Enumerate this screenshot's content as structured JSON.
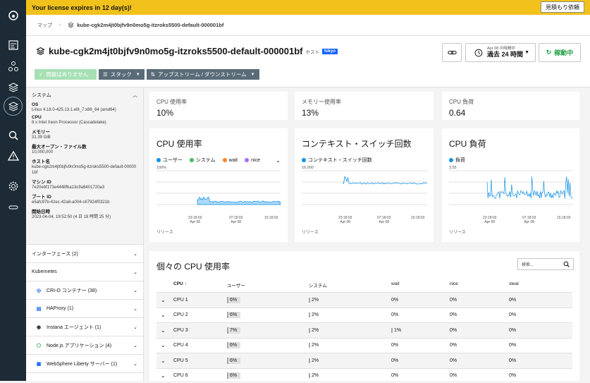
{
  "banner": {
    "text": "Your license expires in 12 day(s)!",
    "button": "見積もり依頼"
  },
  "breadcrumb": {
    "root": "マップ",
    "separator": "›",
    "host": "kube-cgk2m4jt0bjfv9n0mo5g-itzroks5500-default-000001bf"
  },
  "header": {
    "title": "kube-cgk2m4jt0bjfv9n0mo5g-itzroks5500-default-000001bf",
    "kind": "ホスト",
    "zone": "tokyo",
    "status": "問題はありません",
    "stack": "スタック",
    "upstream": "アップストリーム / ダウンストリーム",
    "time_small": "Apr 08 の時間中",
    "time_large": "過去 24 時間",
    "live": "稼動中"
  },
  "system": {
    "heading": "システム",
    "items": [
      {
        "k": "OS",
        "v": "Linux 4.18.0-425.13.1.el8_7.x86_64 (amd64)"
      },
      {
        "k": "CPU",
        "v": "8 x Intel Xeon Processor (Cascadelake)"
      },
      {
        "k": "メモリー",
        "v": "31.39 GiB"
      },
      {
        "k": "最大オープン・ファイル数",
        "v": "10,000,000"
      },
      {
        "k": "ホスト名",
        "v": "kube-cgk2m4jt0bjfv9n0mo5g-itzroks5500-default-000001bf"
      },
      {
        "k": "マシン ID",
        "v": "7e20ebf173e4448fba13c9a6401720a3"
      },
      {
        "k": "ブート ID",
        "v": "e5afc97b-42ec-42a8-a004-c67924f0321b"
      },
      {
        "k": "開始日時",
        "v": "2023-04-04, 19:52:50 (4 日 19 時間 25 分)"
      }
    ]
  },
  "accordions": [
    {
      "label": "インターフェース (2)"
    },
    {
      "label": "Kubernetes"
    }
  ],
  "services": [
    {
      "label": "CRI-O コンテナー (38)",
      "icon": "crio-icon"
    },
    {
      "label": "HAProxy (1)",
      "icon": "haproxy-icon"
    },
    {
      "label": "Instana エージェント (1)",
      "icon": "instana-icon"
    },
    {
      "label": "Node.js アプリケーション (4)",
      "icon": "nodejs-icon"
    },
    {
      "label": "WebSphere Liberty サーバー (1)",
      "icon": "websphere-icon"
    }
  ],
  "kpis": [
    {
      "label": "CPU 使用率",
      "value": "10%"
    },
    {
      "label": "メモリー使用率",
      "value": "13%"
    },
    {
      "label": "CPU 負荷",
      "value": "0.64"
    }
  ],
  "charts": {
    "cpu": {
      "title": "CPU 使用率",
      "legend": [
        {
          "name": "ユーザー",
          "color": "#1192e8"
        },
        {
          "name": "システム",
          "color": "#42be65"
        },
        {
          "name": "wait",
          "color": "#ff832b"
        },
        {
          "name": "nice",
          "color": "#a56eff"
        }
      ],
      "ymax": "100%",
      "ticks": [
        [
          "23:18:03",
          "Apr 08"
        ],
        [
          "07:18:03",
          "Apr 08"
        ],
        [
          "15:18:03",
          ""
        ]
      ],
      "footer": "リリース"
    },
    "ctx": {
      "title": "コンテキスト・スイッチ回数",
      "legend": [
        {
          "name": "コンテキスト・スイッチ回数",
          "color": "#1192e8"
        }
      ],
      "ymax": "16,000",
      "ticks": [
        [
          "23:18:03",
          "Apr 08"
        ],
        [
          "07:18:03",
          "Apr 08"
        ],
        [
          "15:18:03",
          ""
        ]
      ],
      "footer": "リリース"
    },
    "load": {
      "title": "CPU 負荷",
      "legend": [
        {
          "name": "負荷",
          "color": "#1192e8"
        }
      ],
      "ymax": "3.55",
      "ticks": [
        [
          "23:18:03",
          "Apr 08"
        ],
        [
          "07:18:03",
          "Apr 08"
        ],
        [
          "15:18:03",
          ""
        ]
      ],
      "footer": "リリース"
    }
  },
  "table": {
    "title": "個々の CPU 使用率",
    "search_placeholder": "検索...",
    "columns": [
      "CPU ↑",
      "ユーザー",
      "システム",
      "wait",
      "nice",
      "steal"
    ],
    "rows": [
      {
        "cpu": "CPU 1",
        "user": "6%",
        "sys": "2%",
        "wait": "0%",
        "nice": "0%",
        "steal": "0%"
      },
      {
        "cpu": "CPU 2",
        "user": "6%",
        "sys": "2%",
        "wait": "0%",
        "nice": "0%",
        "steal": "0%"
      },
      {
        "cpu": "CPU 3",
        "user": "7%",
        "sys": "2%",
        "wait": "1%",
        "nice": "0%",
        "steal": "0%"
      },
      {
        "cpu": "CPU 4",
        "user": "6%",
        "sys": "2%",
        "wait": "0%",
        "nice": "0%",
        "steal": "0%"
      },
      {
        "cpu": "CPU 5",
        "user": "6%",
        "sys": "2%",
        "wait": "0%",
        "nice": "0%",
        "steal": "0%"
      },
      {
        "cpu": "CPU 6",
        "user": "6%",
        "sys": "2%",
        "wait": "0%",
        "nice": "0%",
        "steal": "0%"
      }
    ]
  }
}
